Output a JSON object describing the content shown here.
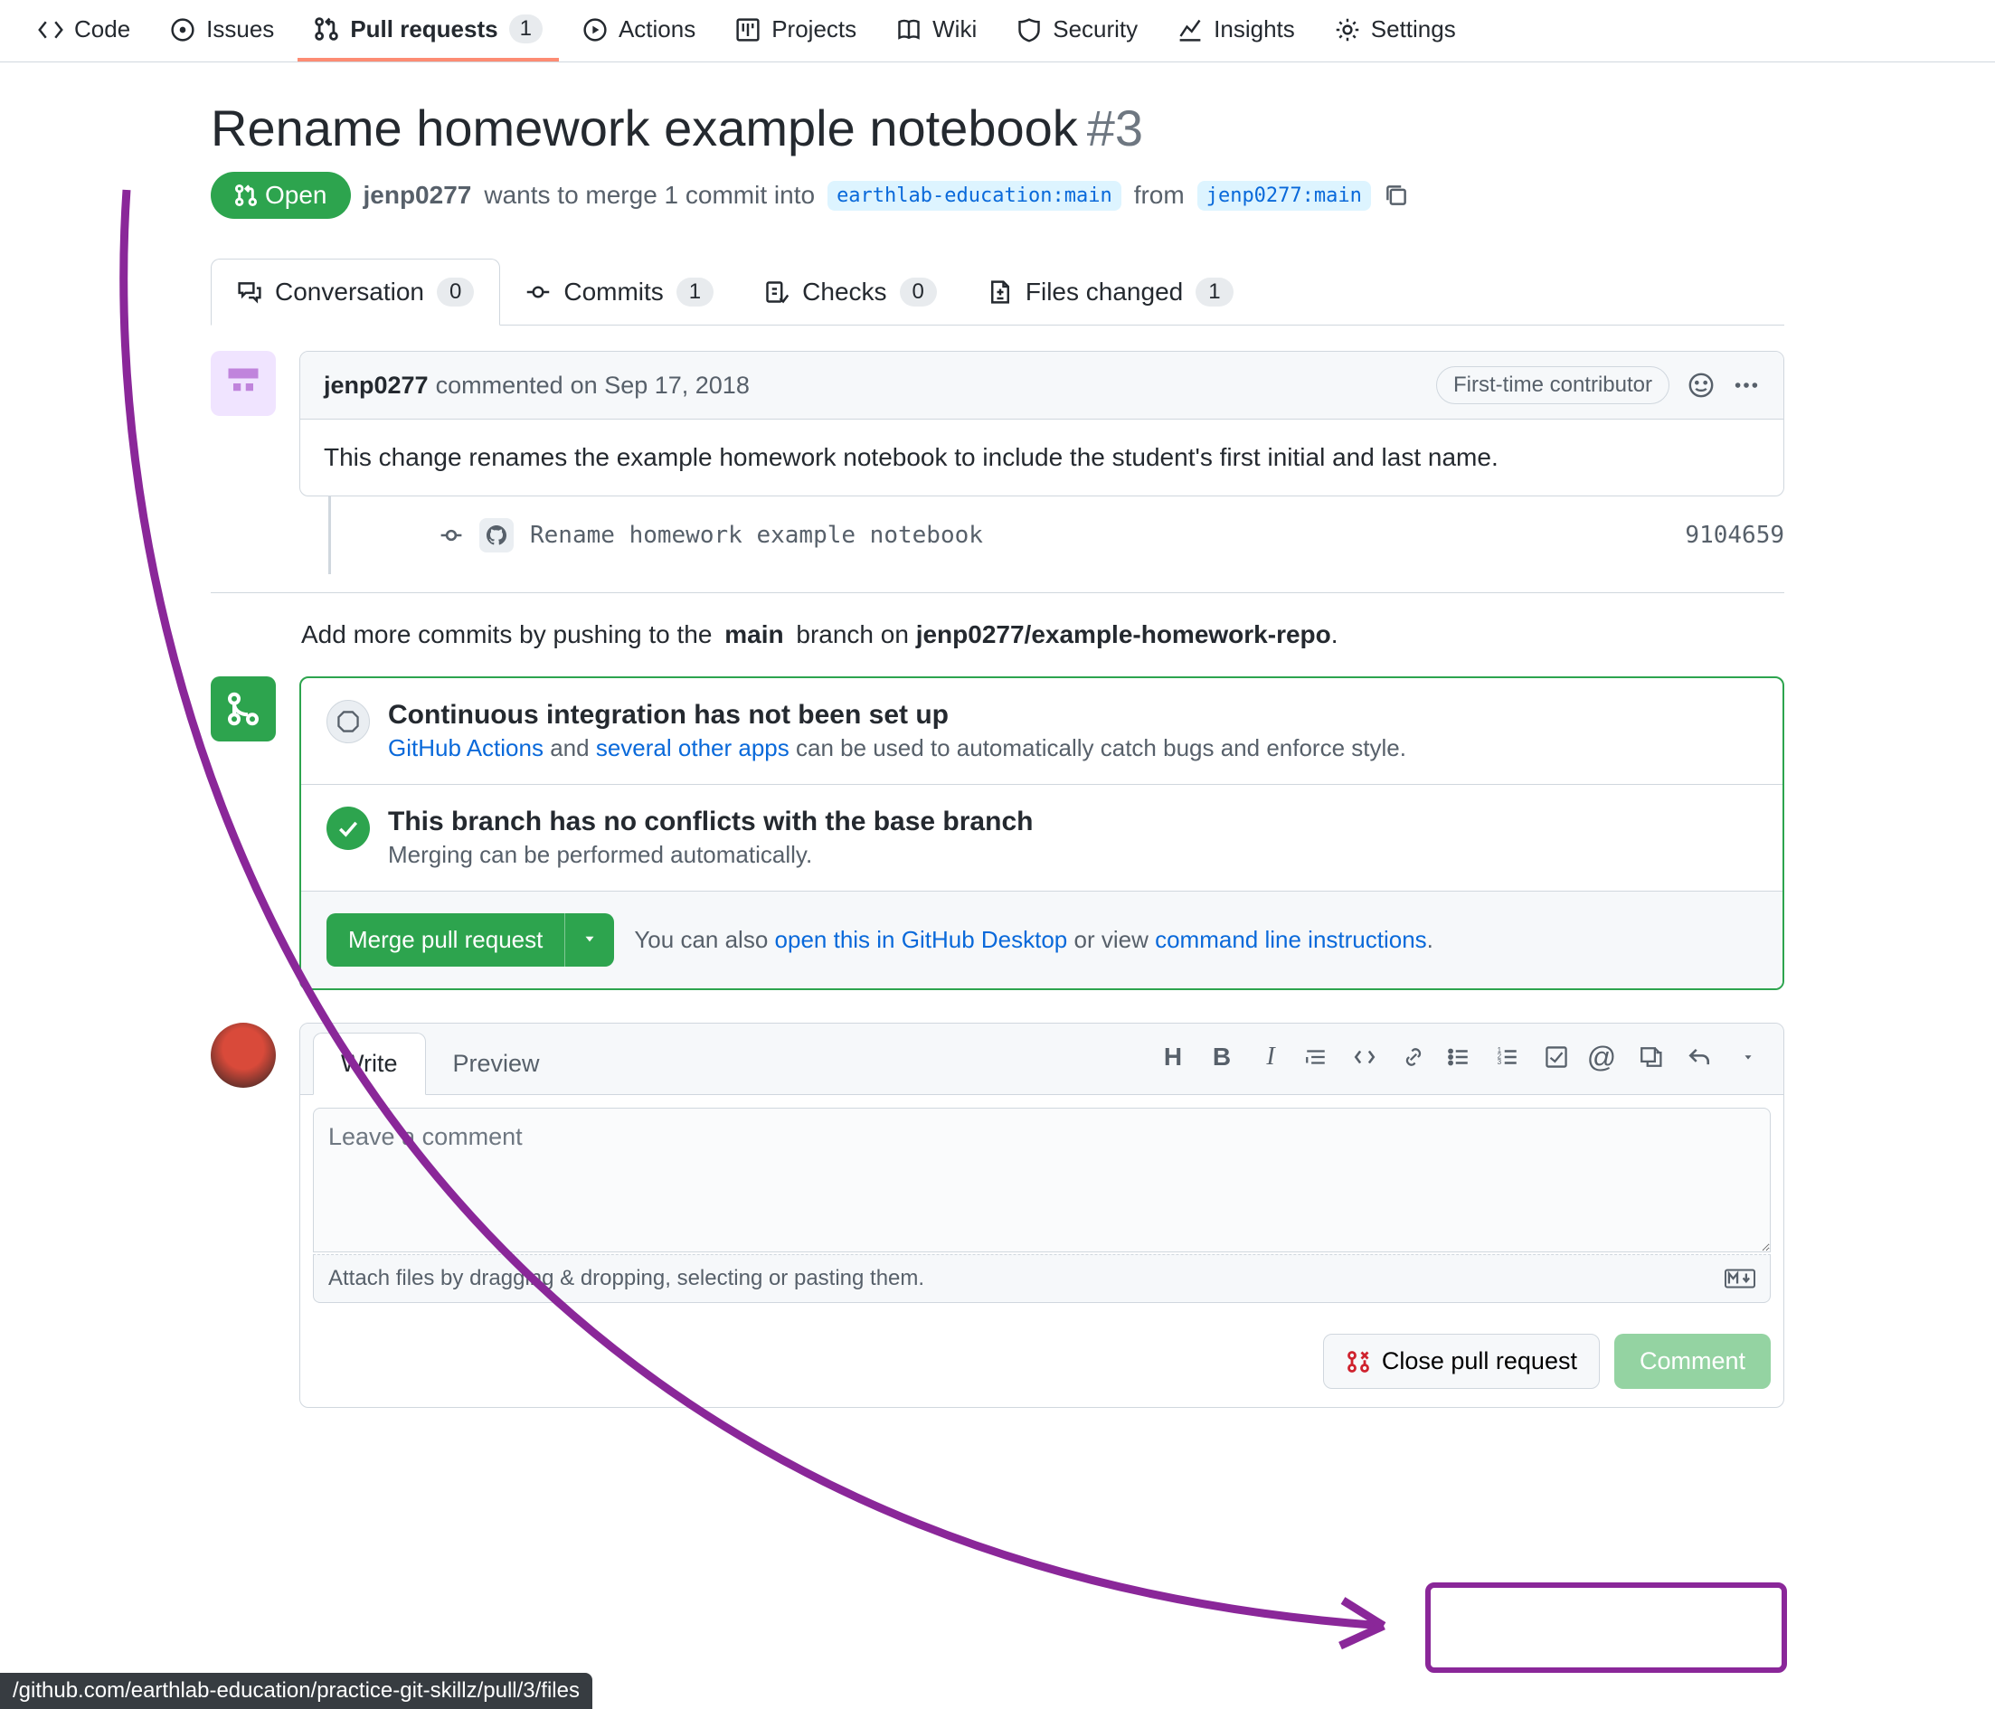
{
  "repo_nav": {
    "code": "Code",
    "issues": "Issues",
    "pull_requests": "Pull requests",
    "pull_requests_count": "1",
    "actions": "Actions",
    "projects": "Projects",
    "wiki": "Wiki",
    "security": "Security",
    "insights": "Insights",
    "settings": "Settings"
  },
  "pr": {
    "title": "Rename homework example notebook",
    "number": "#3",
    "state": "Open",
    "author": "jenp0277",
    "wants_text": "wants to merge 1 commit into",
    "base_branch": "earthlab-education:main",
    "from_text": "from",
    "head_branch": "jenp0277:main"
  },
  "pr_tabs": {
    "conversation": "Conversation",
    "conversation_count": "0",
    "commits": "Commits",
    "commits_count": "1",
    "checks": "Checks",
    "checks_count": "0",
    "files": "Files changed",
    "files_count": "1"
  },
  "first_comment": {
    "author": "jenp0277",
    "verb": "commented",
    "date": "on Sep 17, 2018",
    "badge": "First-time contributor",
    "body": "This change renames the example homework notebook to include the student's first initial and last name."
  },
  "commit": {
    "message": "Rename homework example notebook",
    "sha": "9104659"
  },
  "push_hint": {
    "prefix": "Add more commits by pushing to the",
    "branch": "main",
    "middle": "branch on",
    "repo": "jenp0277/example-homework-repo",
    "suffix": "."
  },
  "ci": {
    "title": "Continuous integration has not been set up",
    "actions_link": "GitHub Actions",
    "and": "and",
    "apps_link": "several other apps",
    "rest": "can be used to automatically catch bugs and enforce style."
  },
  "merge": {
    "title": "This branch has no conflicts with the base branch",
    "sub": "Merging can be performed automatically.",
    "button": "Merge pull request",
    "also_prefix": "You can also",
    "desktop_link": "open this in GitHub Desktop",
    "or_view": "or view",
    "cli_link": "command line instructions",
    "dot": "."
  },
  "compose": {
    "write": "Write",
    "preview": "Preview",
    "placeholder": "Leave a comment",
    "attach": "Attach files by dragging & dropping, selecting or pasting them.",
    "close": "Close pull request",
    "comment": "Comment"
  },
  "status_url": "/github.com/earthlab-education/practice-git-skillz/pull/3/files"
}
